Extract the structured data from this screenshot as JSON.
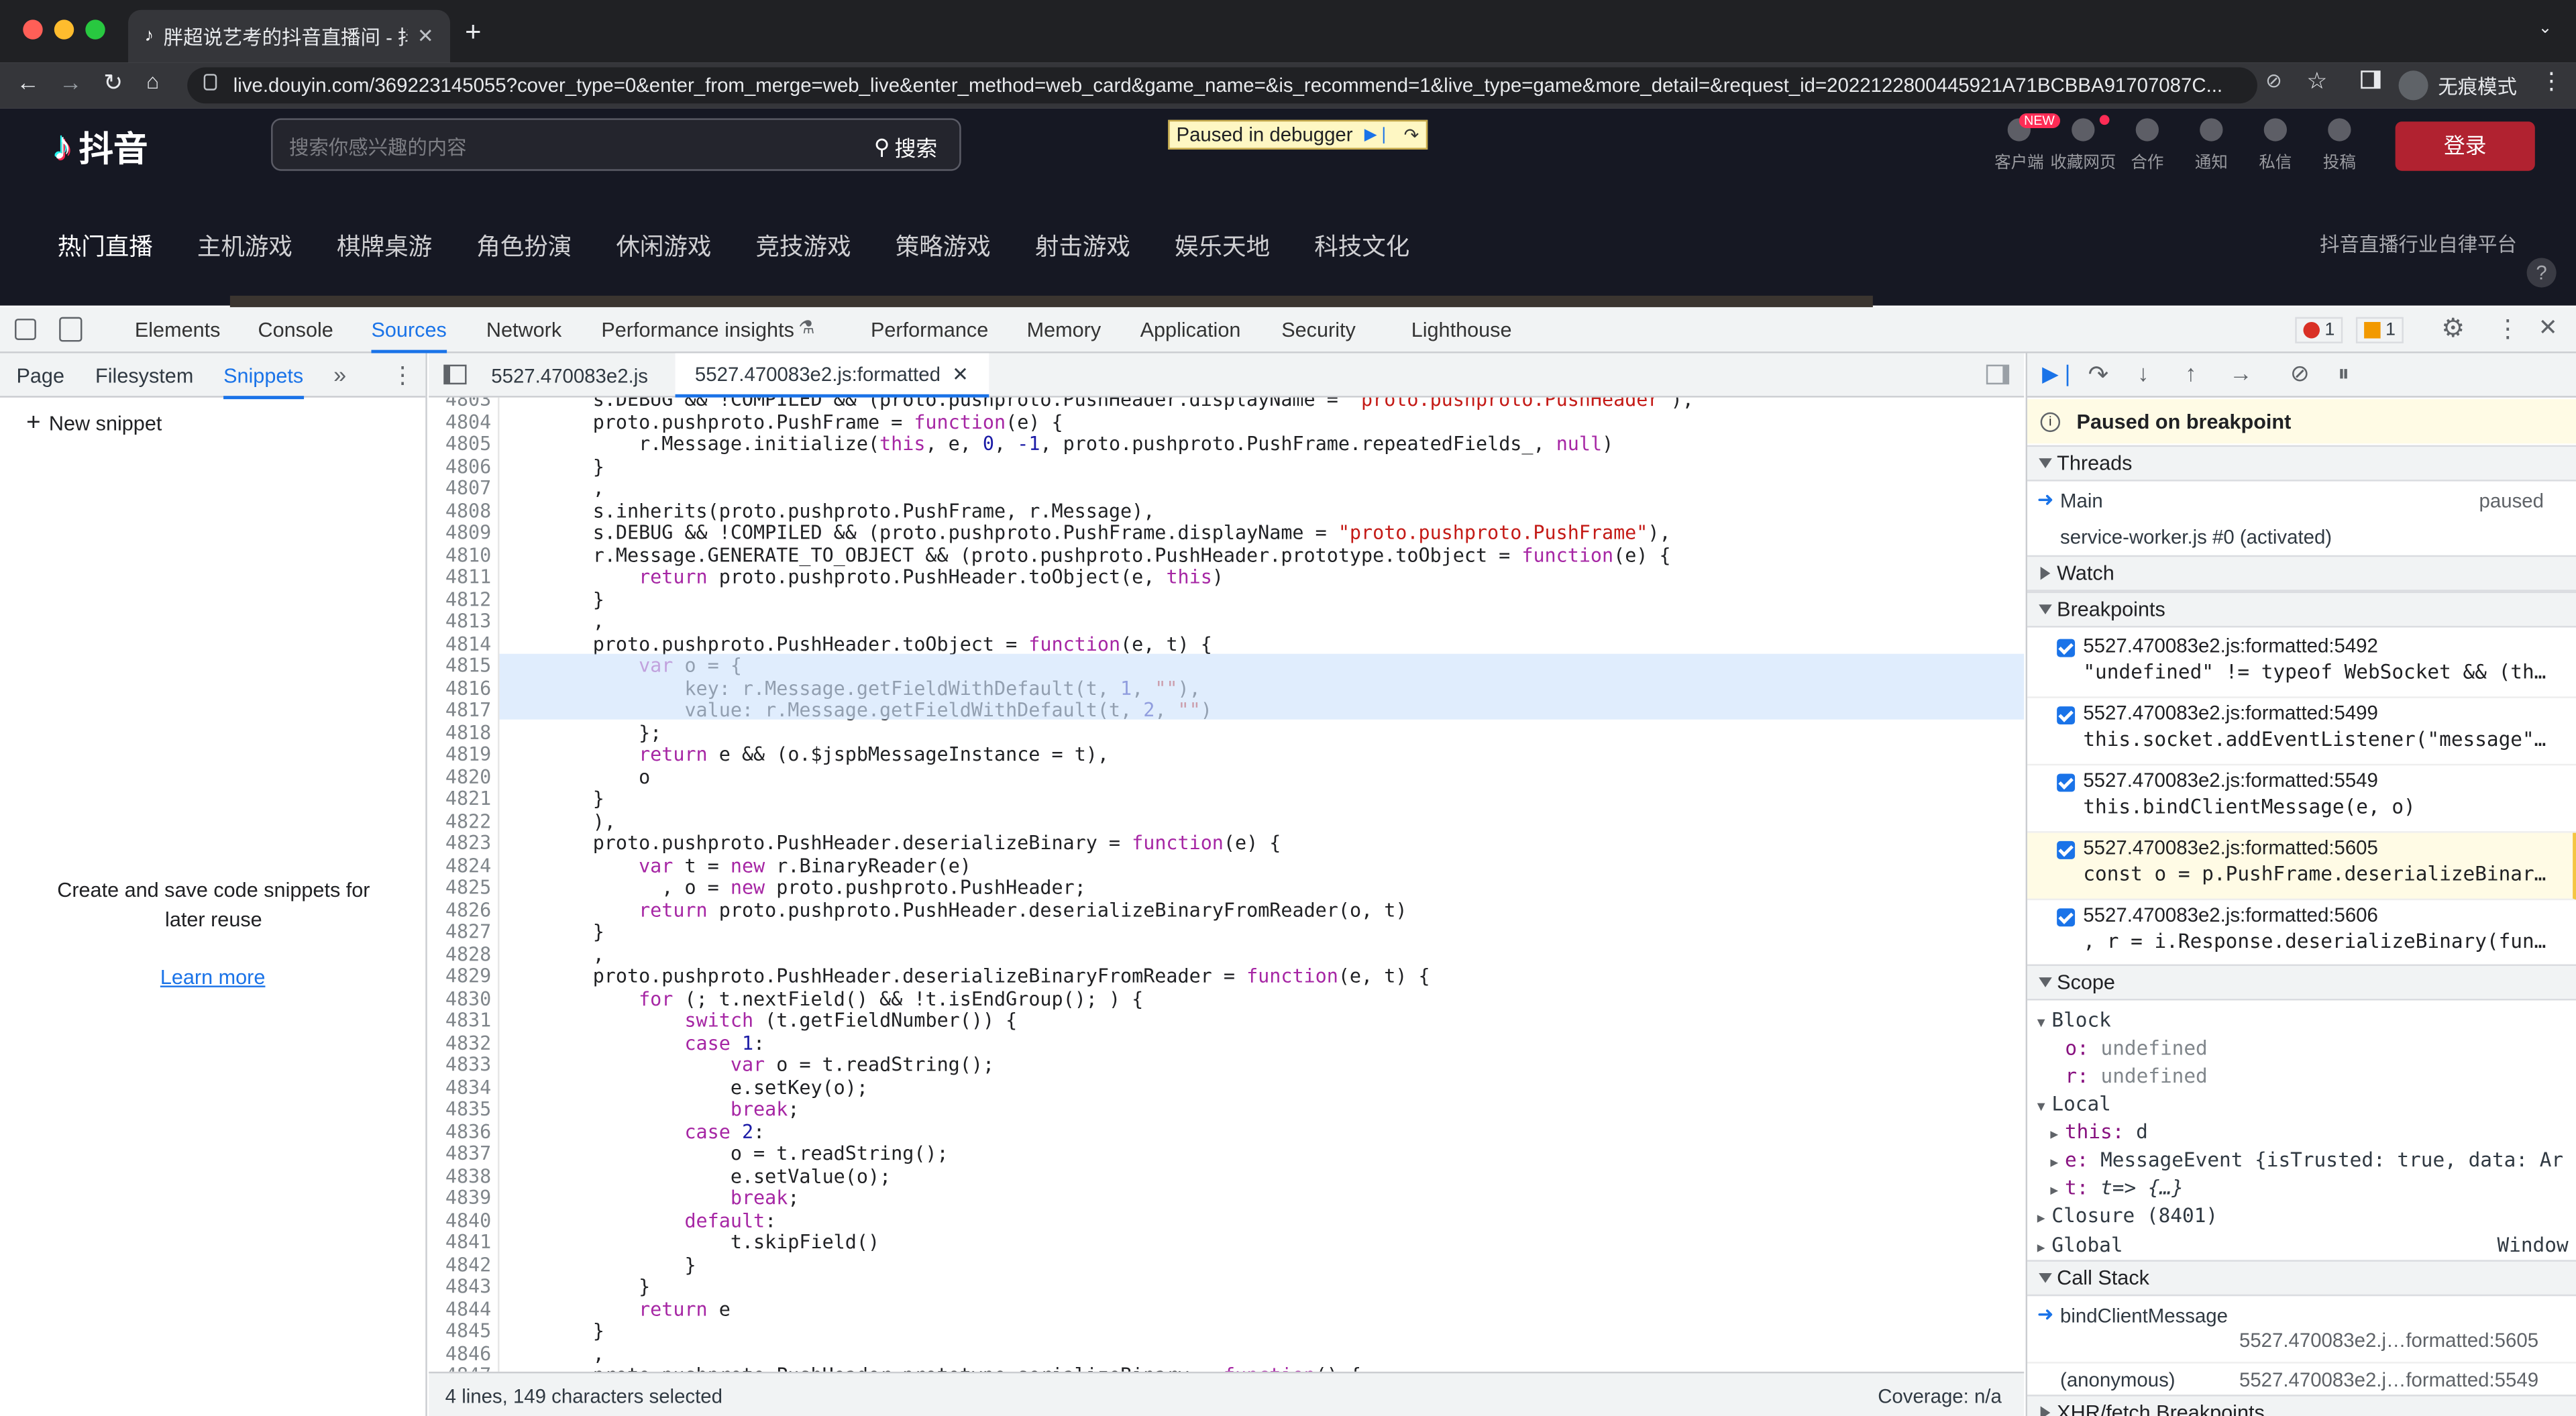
{
  "browser": {
    "tab_title": "胖超说艺考的抖音直播间 - 抖音直",
    "url": "live.douyin.com/369223145055?cover_type=0&enter_from_merge=web_live&enter_method=web_card&game_name=&is_recommend=1&live_type=game&more_detail=&request_id=2022122800445921A71BCBBA91707087C...",
    "incognito_label": "无痕模式"
  },
  "site": {
    "logo": "抖音",
    "search_placeholder": "搜索你感兴趣的内容",
    "search_button": "搜索",
    "debugger_banner": "Paused in debugger",
    "header_icons": [
      {
        "label": "客户端",
        "badge": "NEW"
      },
      {
        "label": "收藏网页"
      },
      {
        "label": "合作"
      },
      {
        "label": "通知"
      },
      {
        "label": "私信"
      },
      {
        "label": "投稿"
      }
    ],
    "login_button": "登录",
    "nav": [
      "热门直播",
      "主机游戏",
      "棋牌桌游",
      "角色扮演",
      "休闲游戏",
      "竞技游戏",
      "策略游戏",
      "射击游戏",
      "娱乐天地",
      "科技文化"
    ],
    "platform_link": "抖音直播行业自律平台",
    "help": "?"
  },
  "devtools": {
    "tabs": [
      "Elements",
      "Console",
      "Sources",
      "Network",
      "Performance insights",
      "Performance",
      "Memory",
      "Application",
      "Security",
      "Lighthouse"
    ],
    "error_count": "1",
    "warning_count": "1",
    "navigator_tabs": [
      "Page",
      "Filesystem",
      "Snippets"
    ],
    "new_snippet": "New snippet",
    "snippets_empty": "Create and save code snippets for later reuse",
    "learn_more": "Learn more",
    "editor_tabs": [
      "5527.470083e2.js",
      "5527.470083e2.js:formatted"
    ],
    "status_left": "4 lines, 149 characters selected",
    "status_right": "Coverage: n/a",
    "paused_message": "Paused on breakpoint",
    "sections": {
      "threads": "Threads",
      "watch": "Watch",
      "breakpoints": "Breakpoints",
      "scope": "Scope",
      "call_stack": "Call Stack",
      "xhr": "XHR/fetch Breakpoints"
    },
    "threads": [
      {
        "name": "Main",
        "state": "paused"
      },
      {
        "name": "service-worker.js #0 (activated)",
        "state": ""
      }
    ],
    "breakpoints": [
      {
        "location": "5527.470083e2.js:formatted:5492",
        "code": "\"undefined\" != typeof WebSocket && (th…"
      },
      {
        "location": "5527.470083e2.js:formatted:5499",
        "code": "this.socket.addEventListener(\"message\"…"
      },
      {
        "location": "5527.470083e2.js:formatted:5549",
        "code": "this.bindClientMessage(e, o)"
      },
      {
        "location": "5527.470083e2.js:formatted:5605",
        "code": "const o = p.PushFrame.deserializeBinar…"
      },
      {
        "location": "5527.470083e2.js:formatted:5606",
        "code": ", r = i.Response.deserializeBinary(fun…"
      }
    ],
    "scope": {
      "block_label": "Block",
      "block_vars": [
        {
          "k": "o:",
          "v": "undefined"
        },
        {
          "k": "r:",
          "v": "undefined"
        }
      ],
      "local_label": "Local",
      "local_vars": [
        {
          "k": "this:",
          "v": "d"
        },
        {
          "k": "e:",
          "v": "MessageEvent {isTrusted: true, data: Ar"
        },
        {
          "k": "t:",
          "v": "t=> {…}"
        }
      ],
      "closure": "Closure (8401)",
      "global": "Global",
      "global_val": "Window"
    },
    "call_stack": [
      {
        "fn": "bindClientMessage",
        "loc": "5527.470083e2.j…formatted:5605"
      },
      {
        "fn": "(anonymous)",
        "loc": "5527.470083e2.j…formatted:5549"
      }
    ],
    "code_lines": [
      {
        "n": "4803",
        "t": "        s.DEBUG && !COMPILED && (proto.pushproto.PushHeader.displayName = \"proto.pushproto.PushHeader\"),"
      },
      {
        "n": "4804",
        "t": "        proto.pushproto.PushFrame = function(e) {"
      },
      {
        "n": "4805",
        "t": "            r.Message.initialize(this, e, 0, -1, proto.pushproto.PushFrame.repeatedFields_, null)"
      },
      {
        "n": "4806",
        "t": "        }"
      },
      {
        "n": "4807",
        "t": "        ,"
      },
      {
        "n": "4808",
        "t": "        s.inherits(proto.pushproto.PushFrame, r.Message),"
      },
      {
        "n": "4809",
        "t": "        s.DEBUG && !COMPILED && (proto.pushproto.PushFrame.displayName = \"proto.pushproto.PushFrame\"),"
      },
      {
        "n": "4810",
        "t": "        r.Message.GENERATE_TO_OBJECT && (proto.pushproto.PushHeader.prototype.toObject = function(e) {"
      },
      {
        "n": "4811",
        "t": "            return proto.pushproto.PushHeader.toObject(e, this)"
      },
      {
        "n": "4812",
        "t": "        }"
      },
      {
        "n": "4813",
        "t": "        ,"
      },
      {
        "n": "4814",
        "t": "        proto.pushproto.PushHeader.toObject = function(e, t) {"
      },
      {
        "n": "4815",
        "t": "            var o = {"
      },
      {
        "n": "4816",
        "t": "                key: r.Message.getFieldWithDefault(t, 1, \"\"),"
      },
      {
        "n": "4817",
        "t": "                value: r.Message.getFieldWithDefault(t, 2, \"\")"
      },
      {
        "n": "4818",
        "t": "            };"
      },
      {
        "n": "4819",
        "t": "            return e && (o.$jspbMessageInstance = t),"
      },
      {
        "n": "4820",
        "t": "            o"
      },
      {
        "n": "4821",
        "t": "        }"
      },
      {
        "n": "4822",
        "t": "        ),"
      },
      {
        "n": "4823",
        "t": "        proto.pushproto.PushHeader.deserializeBinary = function(e) {"
      },
      {
        "n": "4824",
        "t": "            var t = new r.BinaryReader(e)"
      },
      {
        "n": "4825",
        "t": "              , o = new proto.pushproto.PushHeader;"
      },
      {
        "n": "4826",
        "t": "            return proto.pushproto.PushHeader.deserializeBinaryFromReader(o, t)"
      },
      {
        "n": "4827",
        "t": "        }"
      },
      {
        "n": "4828",
        "t": "        ,"
      },
      {
        "n": "4829",
        "t": "        proto.pushproto.PushHeader.deserializeBinaryFromReader = function(e, t) {"
      },
      {
        "n": "4830",
        "t": "            for (; t.nextField() && !t.isEndGroup(); ) {"
      },
      {
        "n": "4831",
        "t": "                switch (t.getFieldNumber()) {"
      },
      {
        "n": "4832",
        "t": "                case 1:"
      },
      {
        "n": "4833",
        "t": "                    var o = t.readString();"
      },
      {
        "n": "4834",
        "t": "                    e.setKey(o);"
      },
      {
        "n": "4835",
        "t": "                    break;"
      },
      {
        "n": "4836",
        "t": "                case 2:"
      },
      {
        "n": "4837",
        "t": "                    o = t.readString();"
      },
      {
        "n": "4838",
        "t": "                    e.setValue(o);"
      },
      {
        "n": "4839",
        "t": "                    break;"
      },
      {
        "n": "4840",
        "t": "                default:"
      },
      {
        "n": "4841",
        "t": "                    t.skipField()"
      },
      {
        "n": "4842",
        "t": "                }"
      },
      {
        "n": "4843",
        "t": "            }"
      },
      {
        "n": "4844",
        "t": "            return e"
      },
      {
        "n": "4845",
        "t": "        }"
      },
      {
        "n": "4846",
        "t": "        ,"
      },
      {
        "n": "4847",
        "t": "        proto.pushproto.PushHeader.prototype.serializeBinary = function() {"
      }
    ]
  }
}
